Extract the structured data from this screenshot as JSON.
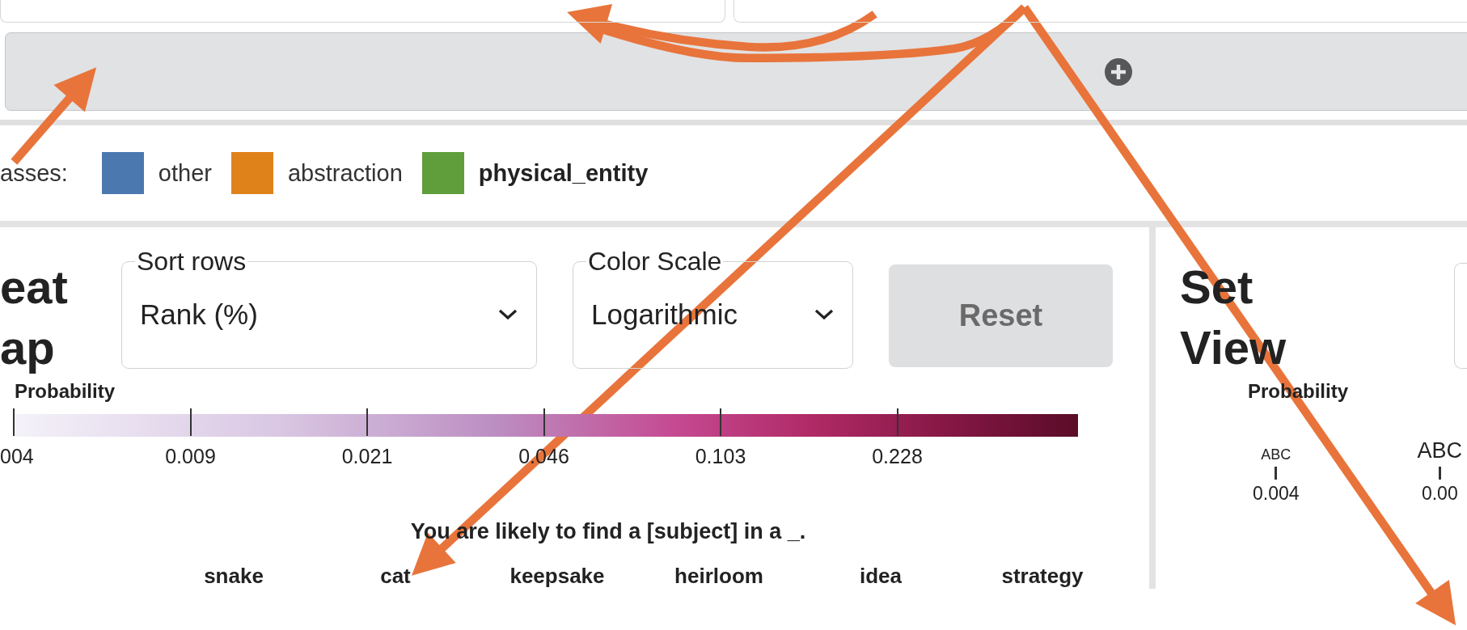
{
  "classes": {
    "label": "asses:",
    "items": [
      {
        "name": "other",
        "color": "#4c78b0",
        "selected": false
      },
      {
        "name": "abstraction",
        "color": "#e0821a",
        "selected": false
      },
      {
        "name": "physical_entity",
        "color": "#5f9e3a",
        "selected": true
      }
    ]
  },
  "heat_map": {
    "title_lines": [
      "eat",
      "ap"
    ],
    "sort_rows": {
      "label": "Sort rows",
      "value": "Rank (%)"
    },
    "color_scale": {
      "label": "Color Scale",
      "value": "Logarithmic"
    },
    "reset_button": "Reset",
    "legend": {
      "title": "Probability",
      "ticks": [
        "004",
        "0.009",
        "0.021",
        "0.046",
        "0.103",
        "0.228"
      ]
    },
    "sentence": "You are likely to find a [subject] in a _.",
    "columns": [
      "snake",
      "cat",
      "keepsake",
      "heirloom",
      "idea",
      "strategy"
    ]
  },
  "set_view": {
    "title_lines": [
      "Set",
      "View"
    ],
    "legend_title": "Probability",
    "size_ticks": [
      {
        "symbol": "ABC",
        "value": "0.004"
      },
      {
        "symbol": "ABC",
        "value": "0.00"
      }
    ]
  }
}
